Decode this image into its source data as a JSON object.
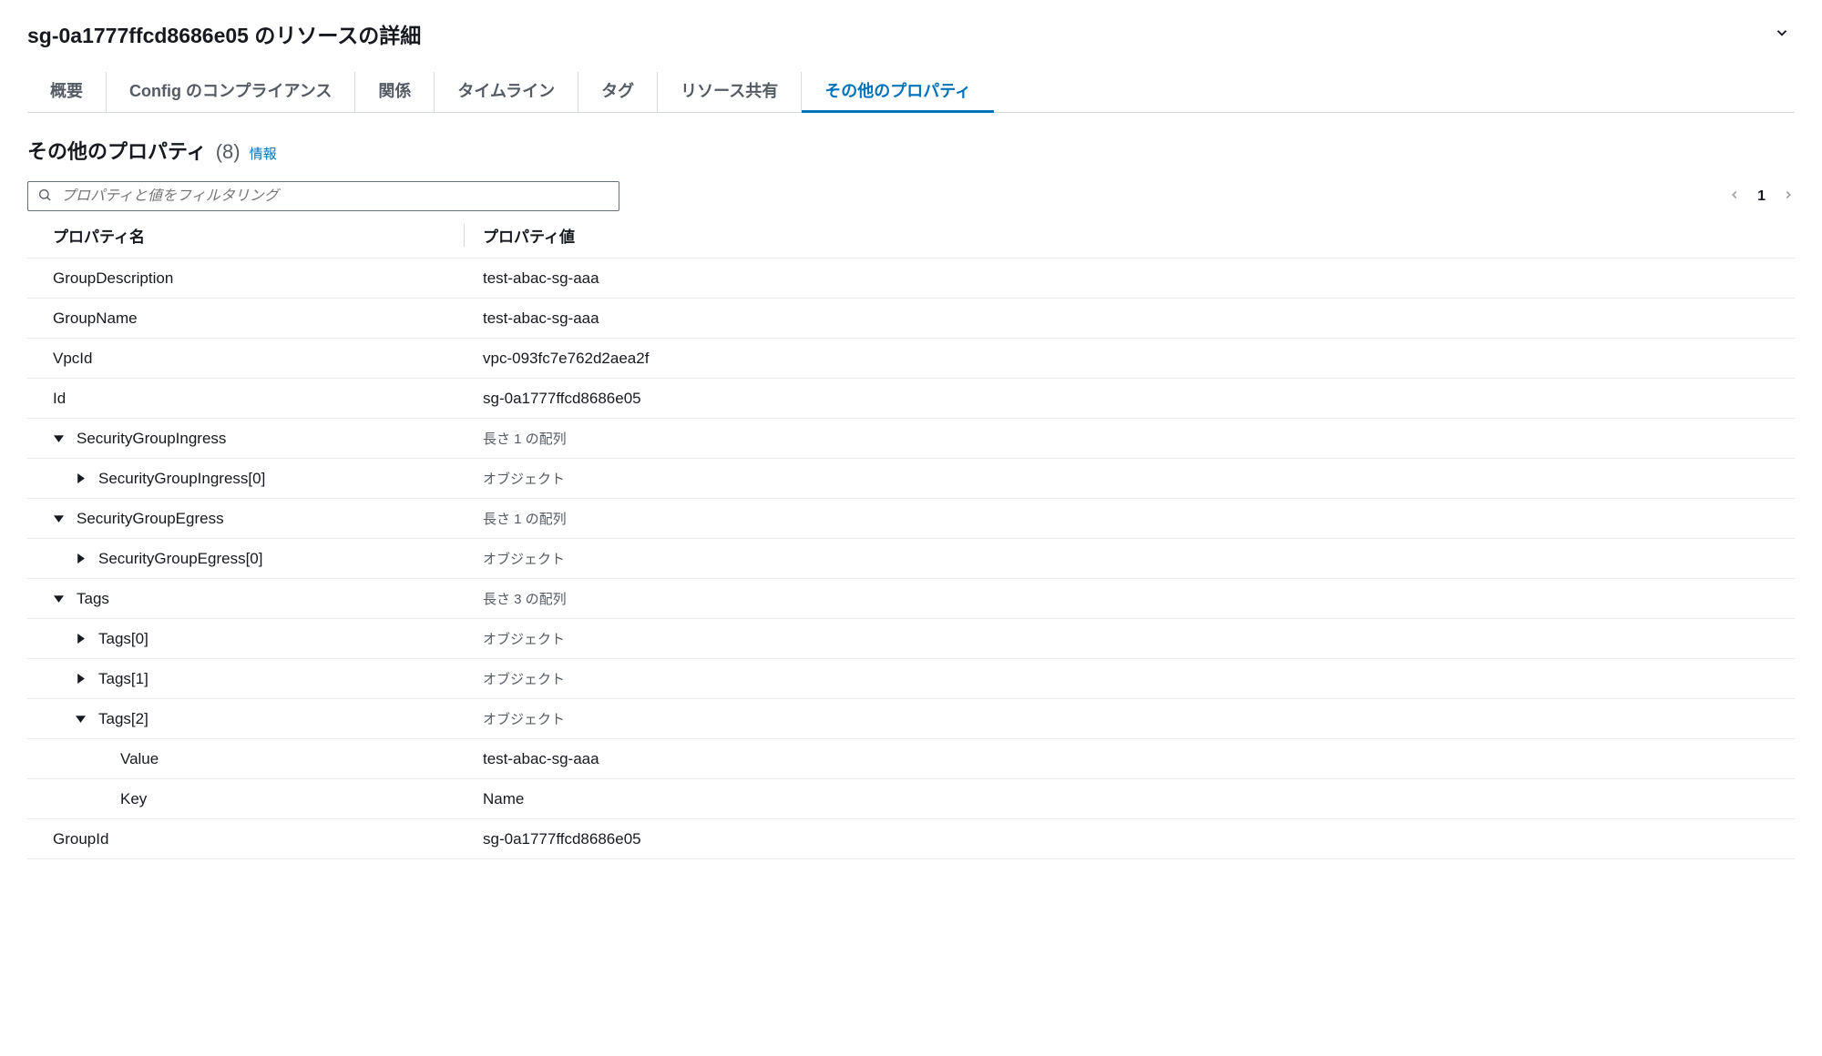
{
  "header": {
    "title": "sg-0a1777ffcd8686e05 のリソースの詳細"
  },
  "tabs": [
    {
      "label": "概要"
    },
    {
      "label": "Config のコンプライアンス"
    },
    {
      "label": "関係"
    },
    {
      "label": "タイムライン"
    },
    {
      "label": "タグ"
    },
    {
      "label": "リソース共有"
    },
    {
      "label": "その他のプロパティ",
      "active": true
    }
  ],
  "section": {
    "title": "その他のプロパティ",
    "count": "(8)",
    "info": "情報"
  },
  "search": {
    "placeholder": "プロパティと値をフィルタリング"
  },
  "pagination": {
    "current": "1"
  },
  "columns": {
    "name": "プロパティ名",
    "value": "プロパティ値"
  },
  "rows": [
    {
      "indent": 0,
      "toggle": null,
      "name": "GroupDescription",
      "value": "test-abac-sg-aaa",
      "muted": false
    },
    {
      "indent": 0,
      "toggle": null,
      "name": "GroupName",
      "value": "test-abac-sg-aaa",
      "muted": false
    },
    {
      "indent": 0,
      "toggle": null,
      "name": "VpcId",
      "value": "vpc-093fc7e762d2aea2f",
      "muted": false
    },
    {
      "indent": 0,
      "toggle": null,
      "name": "Id",
      "value": "sg-0a1777ffcd8686e05",
      "muted": false
    },
    {
      "indent": 0,
      "toggle": "open",
      "name": "SecurityGroupIngress",
      "value": "長さ 1 の配列",
      "muted": true
    },
    {
      "indent": 1,
      "toggle": "closed",
      "name": "SecurityGroupIngress[0]",
      "value": "オブジェクト",
      "muted": true
    },
    {
      "indent": 0,
      "toggle": "open",
      "name": "SecurityGroupEgress",
      "value": "長さ 1 の配列",
      "muted": true
    },
    {
      "indent": 1,
      "toggle": "closed",
      "name": "SecurityGroupEgress[0]",
      "value": "オブジェクト",
      "muted": true
    },
    {
      "indent": 0,
      "toggle": "open",
      "name": "Tags",
      "value": "長さ 3 の配列",
      "muted": true
    },
    {
      "indent": 1,
      "toggle": "closed",
      "name": "Tags[0]",
      "value": "オブジェクト",
      "muted": true
    },
    {
      "indent": 1,
      "toggle": "closed",
      "name": "Tags[1]",
      "value": "オブジェクト",
      "muted": true
    },
    {
      "indent": 1,
      "toggle": "open",
      "name": "Tags[2]",
      "value": "オブジェクト",
      "muted": true
    },
    {
      "indent": 2,
      "toggle": null,
      "name": "Value",
      "value": "test-abac-sg-aaa",
      "muted": false
    },
    {
      "indent": 2,
      "toggle": null,
      "name": "Key",
      "value": "Name",
      "muted": false
    },
    {
      "indent": 0,
      "toggle": null,
      "name": "GroupId",
      "value": "sg-0a1777ffcd8686e05",
      "muted": false
    }
  ]
}
